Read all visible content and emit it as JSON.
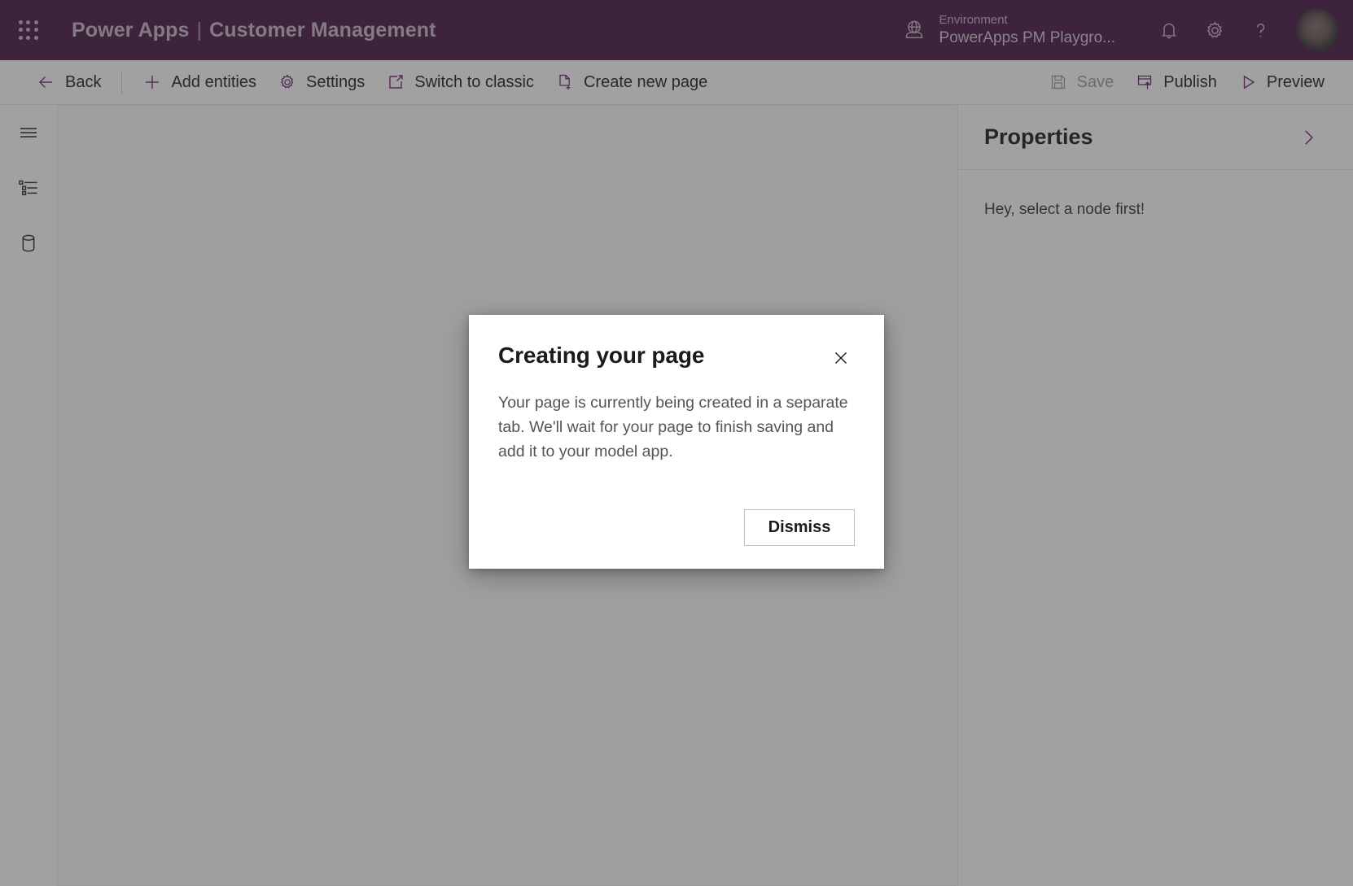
{
  "header": {
    "waffle_icon": "app-launcher-icon",
    "brand": "Power Apps",
    "separator": "|",
    "app_name": "Customer Management",
    "environment_label": "Environment",
    "environment_name": "PowerApps PM Playgro...",
    "globe_icon": "environment-globe-icon",
    "bell_icon": "notifications-bell-icon",
    "gear_icon": "settings-gear-icon",
    "help_icon": "help-question-icon",
    "avatar_icon": "user-avatar"
  },
  "toolbar": {
    "back_label": "Back",
    "add_entities_label": "Add entities",
    "settings_label": "Settings",
    "switch_classic_label": "Switch to classic",
    "create_page_label": "Create new page",
    "save_label": "Save",
    "publish_label": "Publish",
    "preview_label": "Preview",
    "save_disabled": true,
    "accent_color": "#742774"
  },
  "rail": {
    "items": [
      {
        "name": "navigation-menu-icon"
      },
      {
        "name": "tree-view-icon"
      },
      {
        "name": "data-entities-icon"
      }
    ]
  },
  "properties": {
    "title": "Properties",
    "collapse_icon": "chevron-right-icon",
    "empty_message": "Hey, select a node first!"
  },
  "dialog": {
    "title": "Creating your page",
    "close_icon": "close-x-icon",
    "body": "Your page is currently being created in a separate tab. We'll wait for your page to finish saving and add it to your model app.",
    "dismiss_label": "Dismiss"
  }
}
